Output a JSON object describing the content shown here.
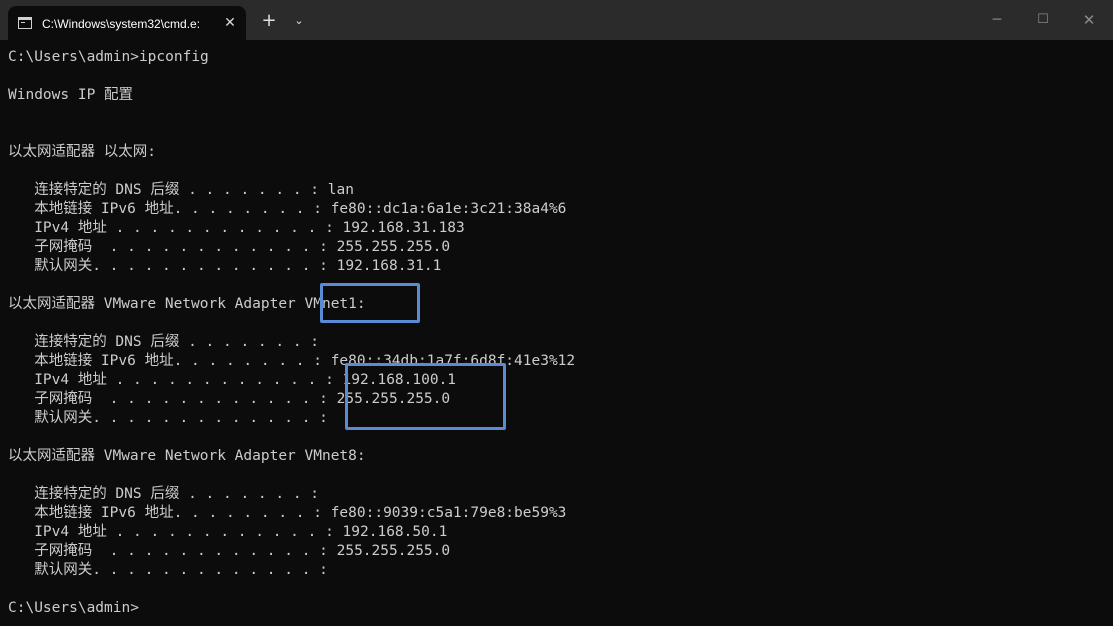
{
  "window": {
    "tab_title": "C:\\Windows\\system32\\cmd.e:",
    "tab_close": "✕",
    "new_tab": "+",
    "dropdown": "⌄",
    "minimize": "─",
    "maximize": "☐",
    "close": "✕"
  },
  "terminal": {
    "lines": [
      "C:\\Users\\admin>ipconfig",
      "",
      "Windows IP 配置",
      "",
      "",
      "以太网适配器 以太网:",
      "",
      "   连接特定的 DNS 后缀 . . . . . . . : lan",
      "   本地链接 IPv6 地址. . . . . . . . : fe80::dc1a:6a1e:3c21:38a4%6",
      "   IPv4 地址 . . . . . . . . . . . . : 192.168.31.183",
      "   子网掩码  . . . . . . . . . . . . : 255.255.255.0",
      "   默认网关. . . . . . . . . . . . . : 192.168.31.1",
      "",
      "以太网适配器 VMware Network Adapter VMnet1:",
      "",
      "   连接特定的 DNS 后缀 . . . . . . . :",
      "   本地链接 IPv6 地址. . . . . . . . : fe80::34db:1a7f:6d8f:41e3%12",
      "   IPv4 地址 . . . . . . . . . . . . : 192.168.100.1",
      "   子网掩码  . . . . . . . . . . . . : 255.255.255.0",
      "   默认网关. . . . . . . . . . . . . :",
      "",
      "以太网适配器 VMware Network Adapter VMnet8:",
      "",
      "   连接特定的 DNS 后缀 . . . . . . . :",
      "   本地链接 IPv6 地址. . . . . . . . : fe80::9039:c5a1:79e8:be59%3",
      "   IPv4 地址 . . . . . . . . . . . . : 192.168.50.1",
      "   子网掩码  . . . . . . . . . . . . : 255.255.255.0",
      "   默认网关. . . . . . . . . . . . . :",
      "",
      "C:\\Users\\admin>"
    ]
  },
  "colors": {
    "background": "#0c0c0c",
    "titlebar": "#2b2b2b",
    "text": "#cccccc",
    "highlight_box": "#5b8ad6"
  }
}
